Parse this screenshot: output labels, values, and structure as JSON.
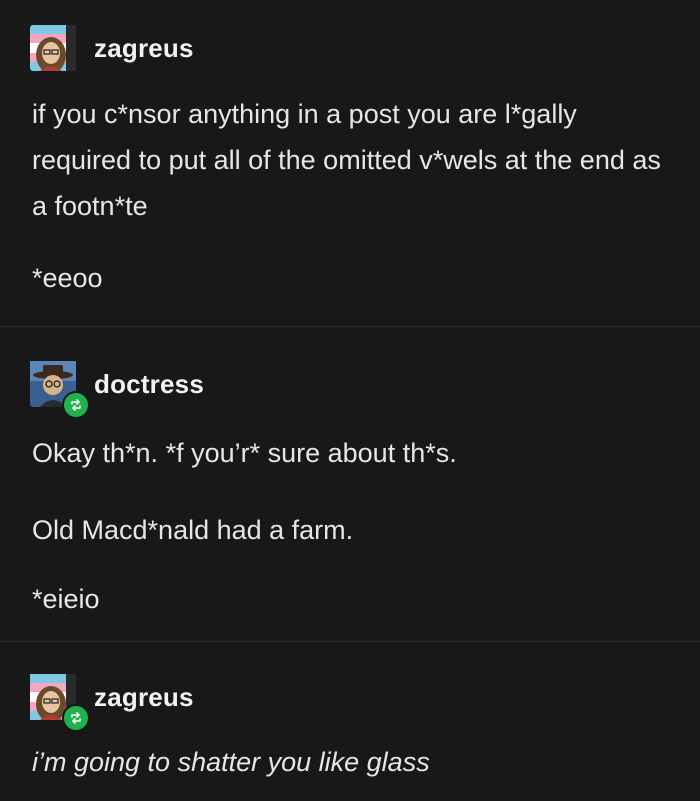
{
  "thread": [
    {
      "username": "zagreus",
      "paragraphs": [
        "if you c*nsor anything in a post you are l*gally required to put all of the omitted v*wels at the end as a footn*te",
        "*eeoo"
      ],
      "avatar_icon": "zagreus-avatar-icon",
      "reblog": false
    },
    {
      "username": "doctress",
      "paragraphs": [
        "Okay th*n. *f you’r* sure about th*s.",
        "Old Macd*nald had a farm.",
        "*eieio"
      ],
      "avatar_icon": "doctress-avatar-icon",
      "reblog": true
    },
    {
      "username": "zagreus",
      "paragraphs": [
        "i’m going to shatter you like glass"
      ],
      "avatar_icon": "zagreus-avatar-icon",
      "reblog": true
    }
  ],
  "colors": {
    "background": "#181818",
    "text": "#e6e6e6",
    "reblog_badge": "#22b14c",
    "divider": "#2c2c2c"
  }
}
